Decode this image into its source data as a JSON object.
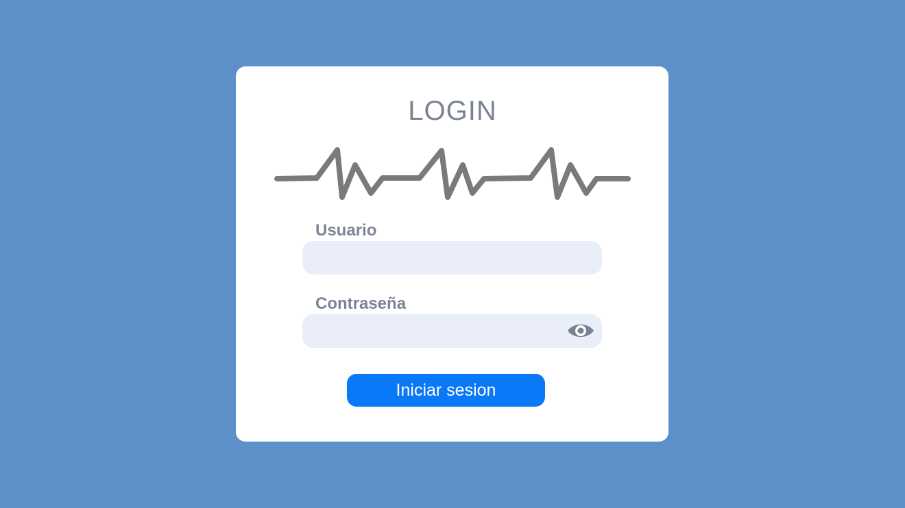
{
  "login": {
    "title": "LOGIN",
    "username_label": "Usuario",
    "username_value": "",
    "password_label": "Contraseña",
    "password_value": "",
    "submit_label": "Iniciar sesion",
    "icons": {
      "decoration": "heartbeat-pulse-icon",
      "toggle_password": "eye-icon"
    }
  },
  "colors": {
    "background": "#5d8fc8",
    "card": "#ffffff",
    "input_bg": "#eaeef9",
    "button": "#0a79f7",
    "text": "#7a8393",
    "pulse": "#7a7a7a"
  }
}
